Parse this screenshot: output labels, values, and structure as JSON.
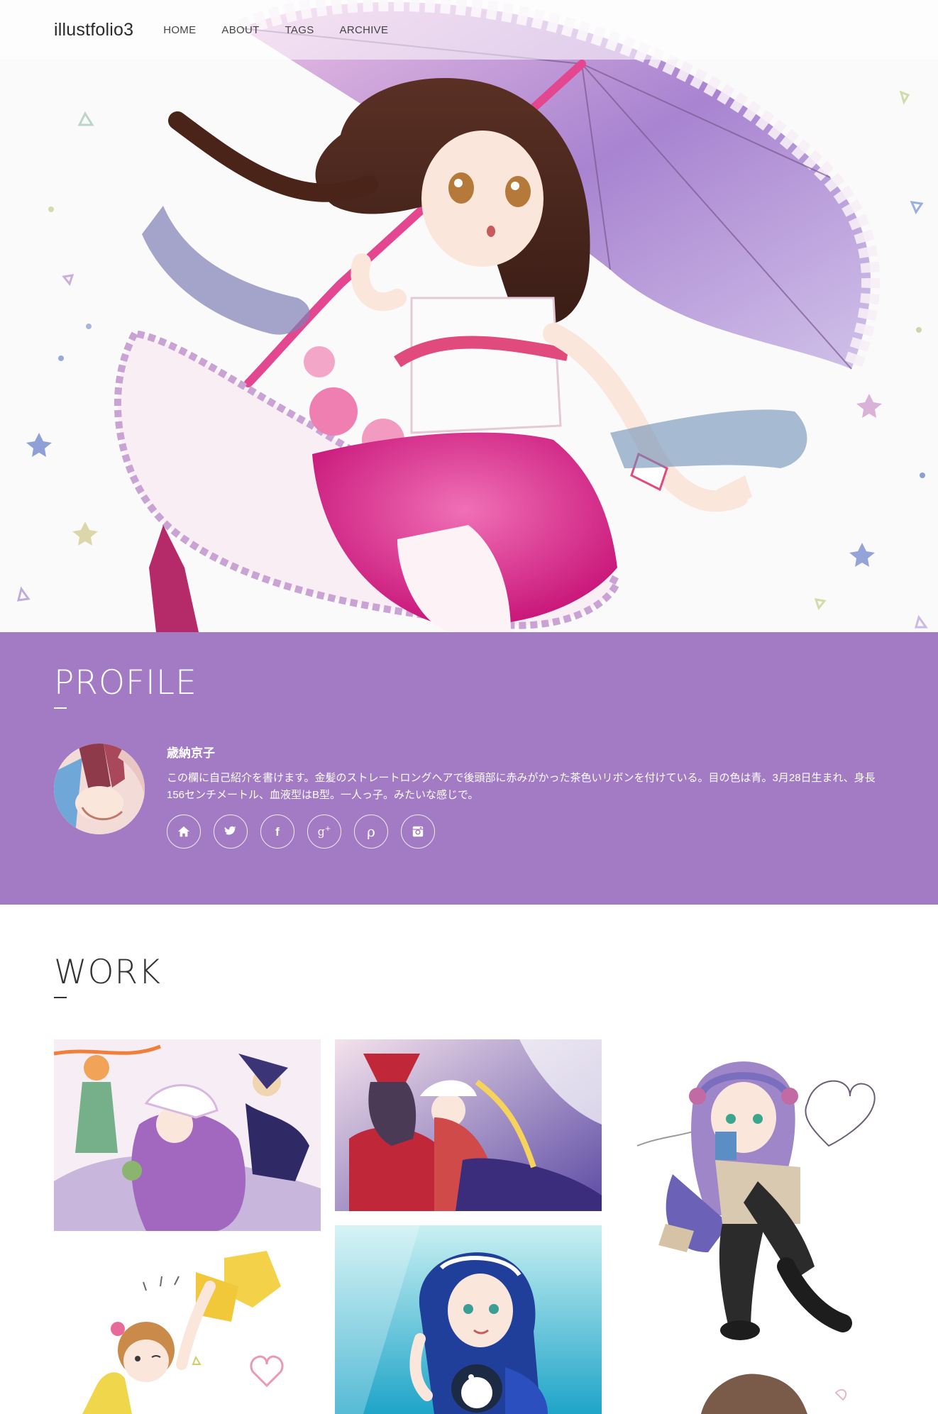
{
  "header": {
    "logo": "illustfolio3",
    "nav": [
      "HOME",
      "ABOUT",
      "TAGS",
      "ARCHIVE"
    ]
  },
  "profile": {
    "title": "PROFILE",
    "name": "歳納京子",
    "bio": "この欄に自己紹介を書けます。金髪のストレートロングヘアで後頭部に赤みがかった茶色いリボンを付けている。目の色は青。3月28日生まれ、身長156センチメートル、血液型はB型。一人っ子。みたいな感じで。",
    "social": [
      {
        "icon": "home-icon"
      },
      {
        "icon": "twitter-icon"
      },
      {
        "icon": "facebook-icon"
      },
      {
        "icon": "google-plus-icon"
      },
      {
        "icon": "pinterest-icon"
      },
      {
        "icon": "instagram-icon"
      }
    ]
  },
  "work": {
    "title": "WORK",
    "items": [
      {
        "name": "artwork-1"
      },
      {
        "name": "artwork-2"
      },
      {
        "name": "artwork-3"
      },
      {
        "name": "artwork-4"
      },
      {
        "name": "artwork-5"
      },
      {
        "name": "artwork-6"
      }
    ]
  },
  "colors": {
    "profile_bg": "#a27bc4",
    "header_bg": "rgba(255,255,255,0.55)",
    "text_dark": "#333333"
  }
}
